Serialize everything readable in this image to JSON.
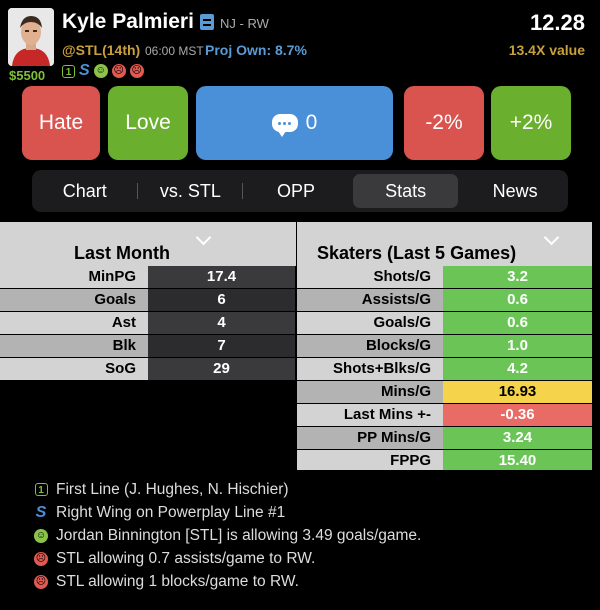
{
  "player": {
    "name": "Kyle Palmieri",
    "team_pos": "NJ - RW",
    "salary": "$5500",
    "points": "12.28",
    "matchup": "@STL(14th)",
    "time": "06:00 MST",
    "proj_own": "Proj Own: 8.7%",
    "value": "13.4X value",
    "badges": [
      "line-one-icon",
      "powerplay-icon",
      "smile-icon",
      "frown-icon",
      "frown-icon"
    ]
  },
  "actions": {
    "hate": "Hate",
    "love": "Love",
    "comments": "0",
    "minus": "-2%",
    "plus": "+2%"
  },
  "tabs": [
    "Chart",
    "vs. STL",
    "OPP",
    "Stats",
    "News"
  ],
  "active_tab": "Stats",
  "last_month": {
    "title": "Last Month",
    "rows": [
      {
        "label": "MinPG",
        "value": "17.4"
      },
      {
        "label": "Goals",
        "value": "6"
      },
      {
        "label": "Ast",
        "value": "4"
      },
      {
        "label": "Blk",
        "value": "7"
      },
      {
        "label": "SoG",
        "value": "29"
      }
    ]
  },
  "last5": {
    "title": "Skaters (Last 5 Games)",
    "rows": [
      {
        "label": "Shots/G",
        "value": "3.2",
        "status": "good"
      },
      {
        "label": "Assists/G",
        "value": "0.6",
        "status": "good"
      },
      {
        "label": "Goals/G",
        "value": "0.6",
        "status": "good"
      },
      {
        "label": "Blocks/G",
        "value": "1.0",
        "status": "good"
      },
      {
        "label": "Shots+Blks/G",
        "value": "4.2",
        "status": "good"
      },
      {
        "label": "Mins/G",
        "value": "16.93",
        "status": "neutral"
      },
      {
        "label": "Last Mins +-",
        "value": "-0.36",
        "status": "bad"
      },
      {
        "label": "PP Mins/G",
        "value": "3.24",
        "status": "good"
      },
      {
        "label": "FPPG",
        "value": "15.40",
        "status": "good"
      }
    ]
  },
  "notes": [
    {
      "icon": "line-one-icon",
      "text": "First Line (J. Hughes, N. Hischier)"
    },
    {
      "icon": "powerplay-icon",
      "text": "Right Wing on Powerplay Line #1"
    },
    {
      "icon": "smile-icon",
      "text": "Jordan Binnington [STL] is allowing 3.49 goals/game."
    },
    {
      "icon": "frown-icon",
      "text": "STL allowing 0.7 assists/game to RW."
    },
    {
      "icon": "frown-icon",
      "text": "STL allowing 1 blocks/game to RW."
    }
  ],
  "colors": {
    "good": "#6bc556",
    "neutral": "#f5d34a",
    "bad": "#e86b66",
    "accent": "#4a90d9"
  }
}
